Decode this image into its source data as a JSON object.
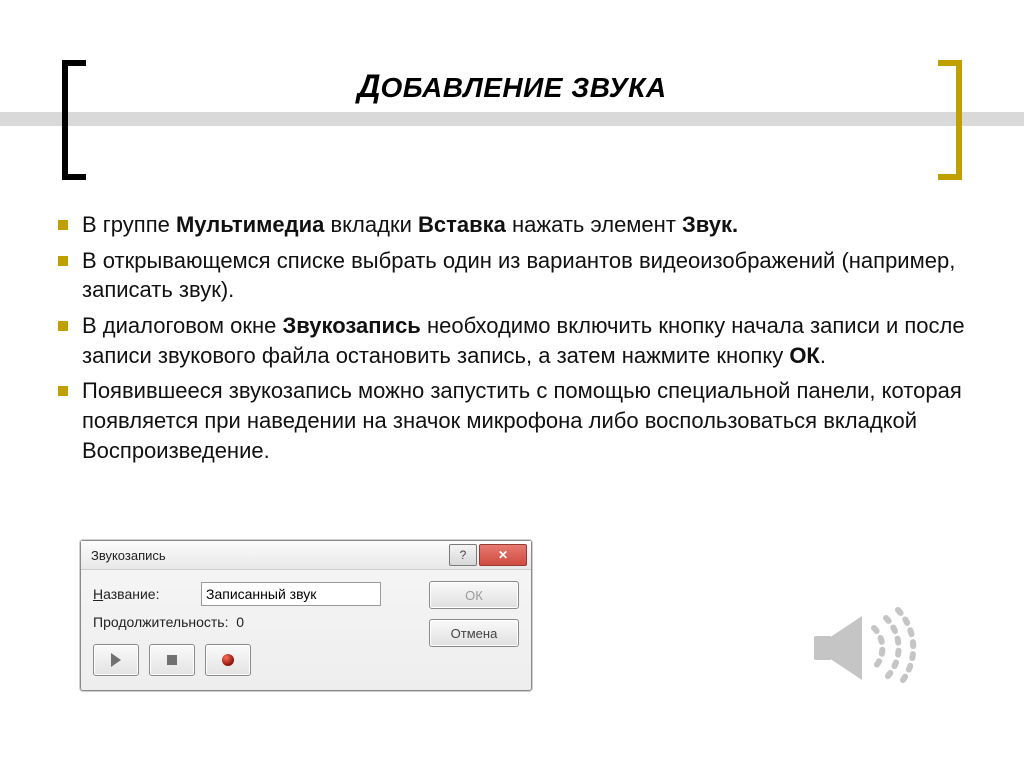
{
  "title": {
    "first_letter": "Д",
    "rest": "ОБАВЛЕНИЕ ЗВУКА"
  },
  "bullets": {
    "b1": {
      "pre": "В группе ",
      "bold1": "Мультимедиа",
      "mid": " вкладки ",
      "bold2": "Вставка",
      "mid2": " нажать элемент ",
      "bold3": "Звук."
    },
    "b2": "В открывающемся списке выбрать один из вариантов видеоизображений (например, записать звук).",
    "b3": {
      "pre": "В диалоговом окне ",
      "bold1": "Звукозапись",
      "mid": " необходимо включить кнопку начала записи и после записи звукового файла остановить запись, а затем нажмите кнопку ",
      "bold2": "ОК",
      "post": "."
    },
    "b4": "Появившееся звукозапись можно запустить с помощью специальной панели, которая появляется при наведении на значок микрофона либо воспользоваться вкладкой Воспроизведение."
  },
  "dialog": {
    "title": "Звукозапись",
    "help_glyph": "?",
    "close_glyph": "✕",
    "name_label_u": "Н",
    "name_label_rest": "азвание:",
    "name_value": "Записанный звук",
    "duration_label": "Продолжительность:",
    "duration_value": "0",
    "ok_label": "ОК",
    "cancel_label": "Отмена"
  }
}
